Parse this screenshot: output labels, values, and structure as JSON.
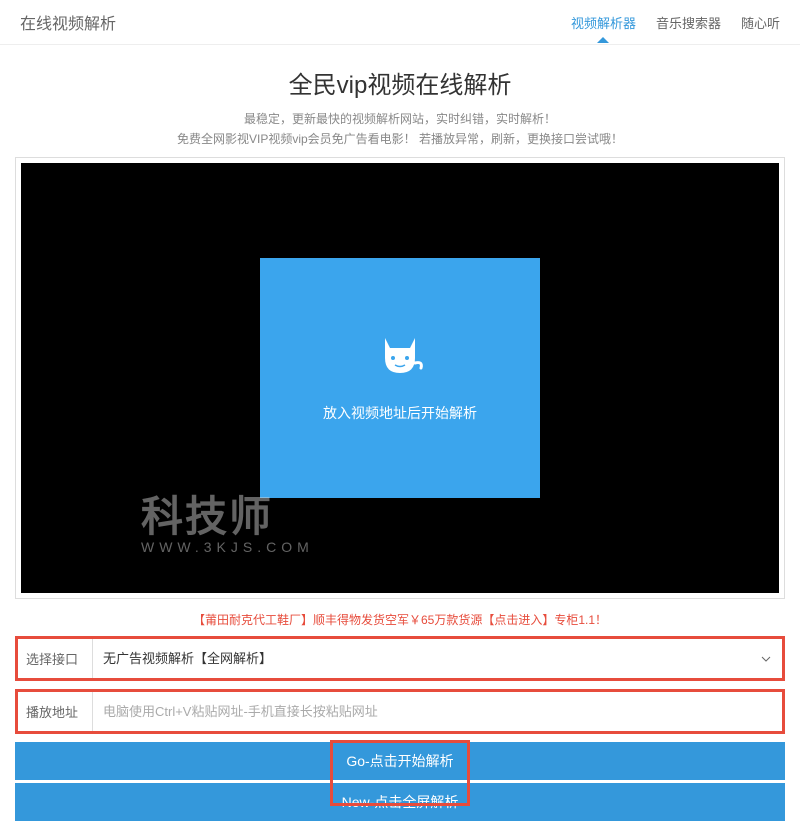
{
  "header": {
    "title": "在线视频解析",
    "nav": [
      {
        "label": "视频解析器",
        "active": true
      },
      {
        "label": "音乐搜索器",
        "active": false
      },
      {
        "label": "随心听",
        "active": false
      }
    ]
  },
  "main": {
    "title": "全民vip视频在线解析",
    "subtitle1": "最稳定，更新最快的视频解析网站，实时纠错，实时解析！",
    "subtitle2": "免费全网影视VIP视频vip会员免广告看电影！ 若播放异常，刷新，更换接口尝试哦！"
  },
  "player": {
    "prompt": "放入视频地址后开始解析"
  },
  "watermark": {
    "main": "科技师",
    "sub": "WWW.3KJS.COM"
  },
  "promo": "【莆田耐克代工鞋厂】顺丰得物发货空军￥65万款货源【点击进入】专柜1.1！",
  "form": {
    "interface_label": "选择接口",
    "interface_value": "无广告视频解析【全网解析】",
    "url_label": "播放地址",
    "url_placeholder": "电脑使用Ctrl+V粘贴网址-手机直接长按粘贴网址"
  },
  "buttons": {
    "go": "Go-点击开始解析",
    "new": "New-点击全屏解析"
  }
}
